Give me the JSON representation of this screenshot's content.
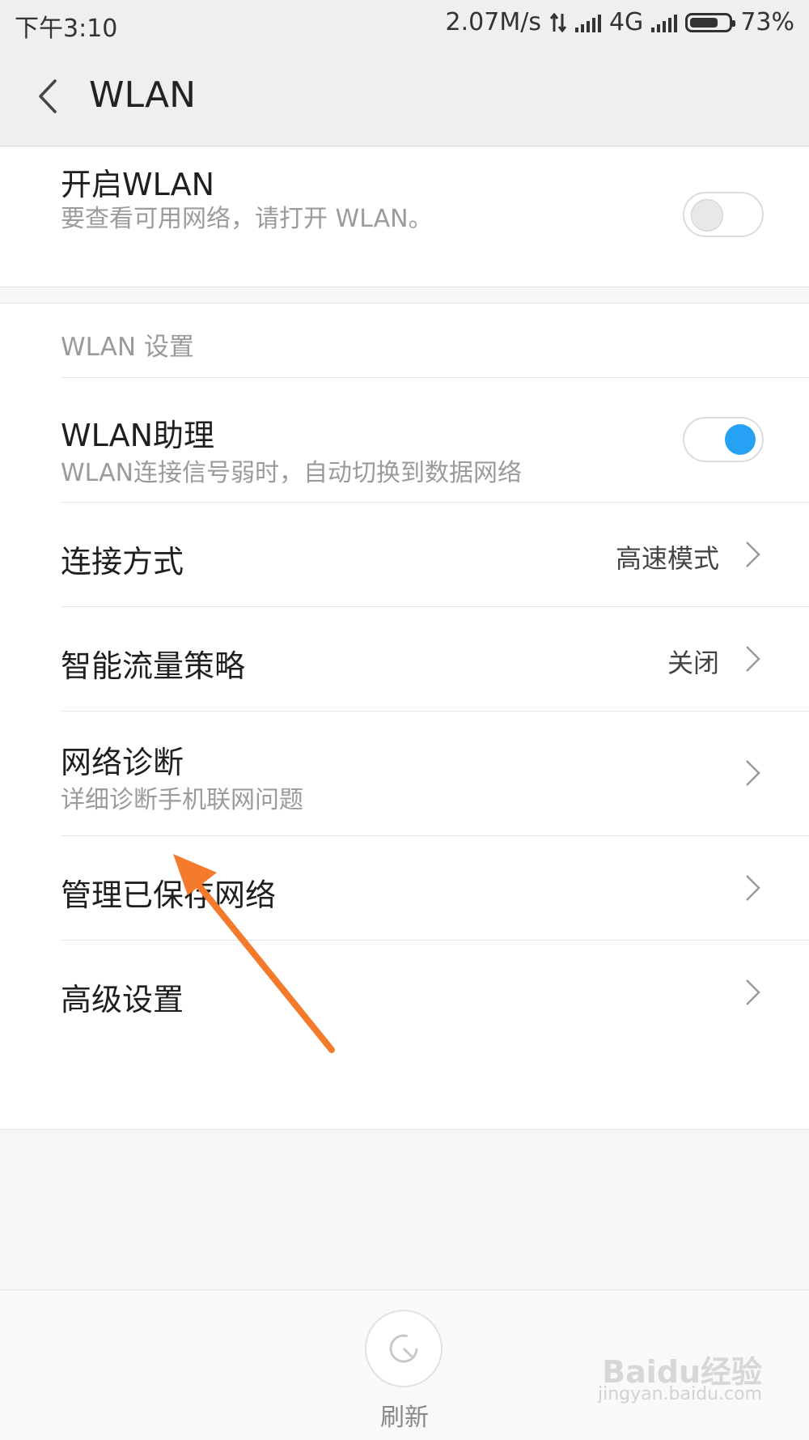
{
  "status_bar": {
    "time": "下午3:10",
    "net_speed": "2.07M/s",
    "network": "4G",
    "battery": "73%",
    "battery_level": 0.73
  },
  "header": {
    "title": "WLAN"
  },
  "wlan_switch": {
    "title": "开启WLAN",
    "subtitle": "要查看可用网络，请打开 WLAN。",
    "enabled": false
  },
  "settings": {
    "section_label": "WLAN 设置",
    "assistant": {
      "title": "WLAN助理",
      "subtitle": "WLAN连接信号弱时，自动切换到数据网络",
      "enabled": true
    },
    "connection_mode": {
      "title": "连接方式",
      "value": "高速模式"
    },
    "smart_traffic": {
      "title": "智能流量策略",
      "value": "关闭"
    },
    "diagnosis": {
      "title": "网络诊断",
      "subtitle": "详细诊断手机联网问题"
    },
    "saved_networks": {
      "title": "管理已保存网络"
    },
    "advanced": {
      "title": "高级设置"
    }
  },
  "bottom": {
    "refresh_label": "刷新",
    "watermark": "Baidu经验",
    "watermark_url": "jingyan.baidu.com"
  },
  "colors": {
    "accent": "#26a1f3",
    "annotation": "#f47a2c"
  }
}
